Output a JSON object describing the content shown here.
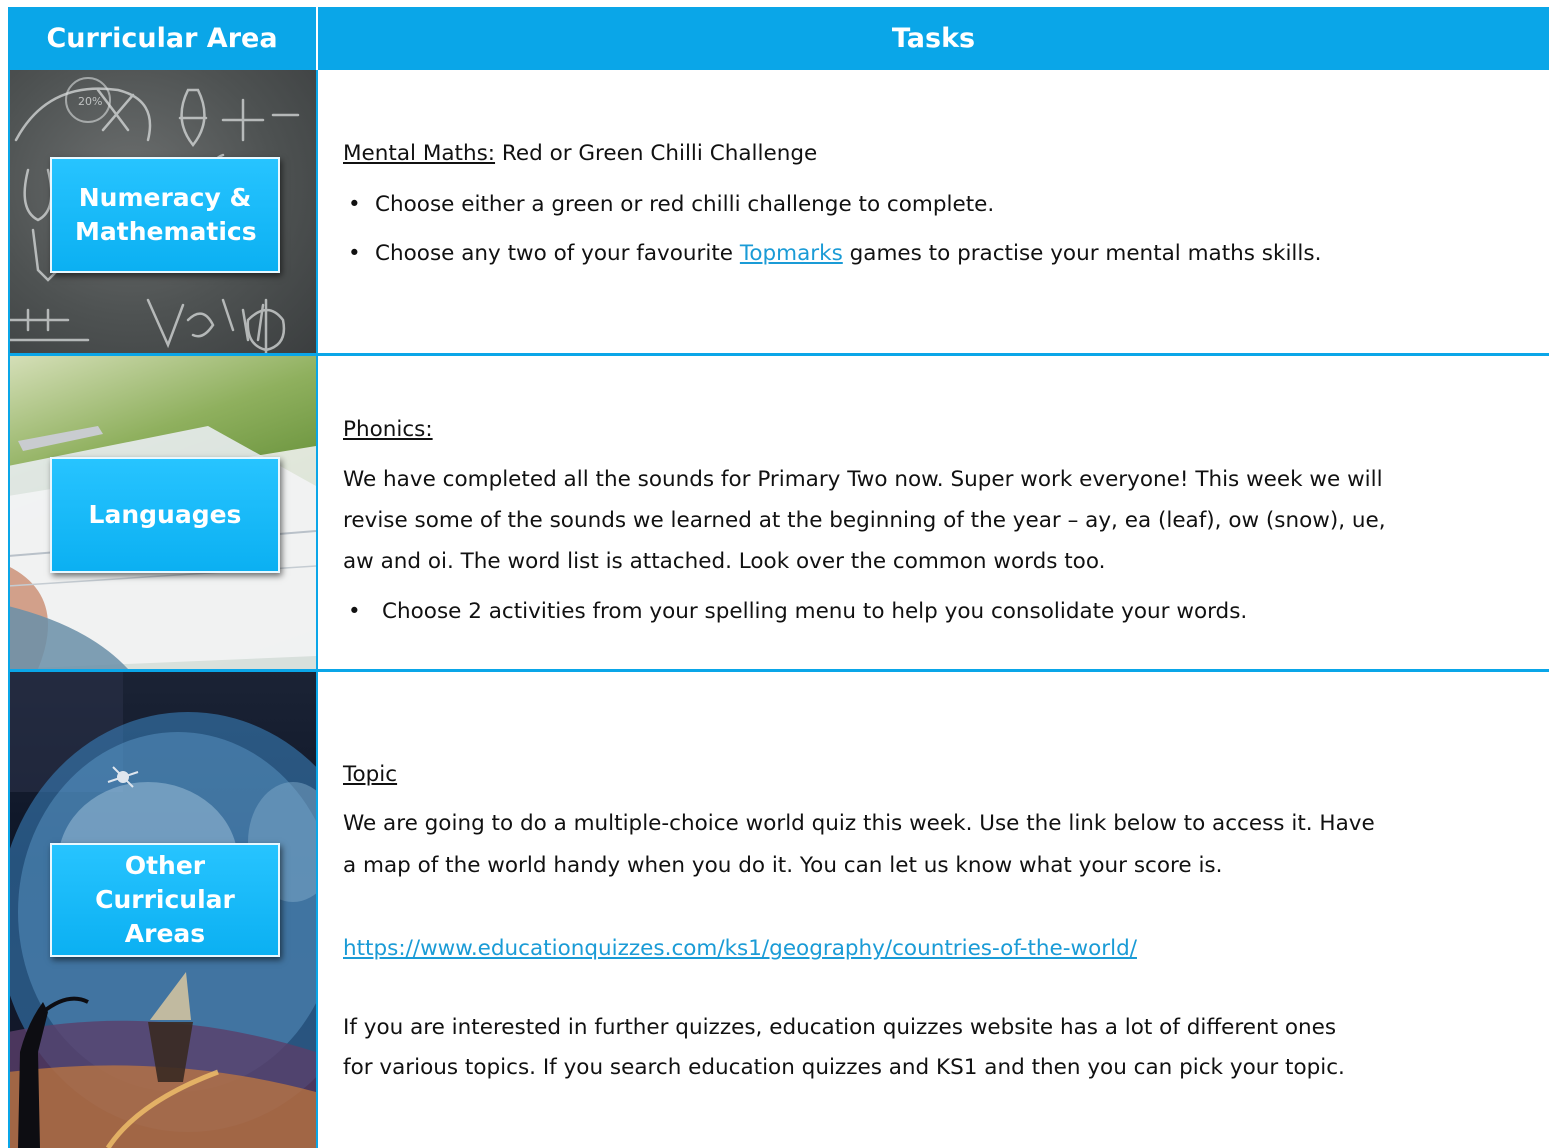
{
  "header": {
    "col1": "Curricular Area",
    "col2": "Tasks"
  },
  "rows": [
    {
      "label": "Numeracy & Mathematics",
      "heading": "Mental Maths:",
      "heading_rest": " Red or Green Chilli Challenge",
      "bullets": [
        "Choose either a green or red chilli challenge to complete.",
        "Choose any two of your favourite "
      ],
      "link_text": "Topmarks",
      "bullet2_rest": " games to practise your mental maths skills."
    },
    {
      "label": "Languages",
      "heading": "Phonics:",
      "para_line1": "We have completed all the sounds for Primary Two now. Super work everyone! This week we will",
      "para_line2": "revise some of the sounds we learned at the beginning of the year – ay, ea (leaf), ow (snow), ue,",
      "para_line3": "aw and oi. The word list is attached. Look over the common words too.",
      "bullet": "Choose 2 activities from your spelling menu to help you consolidate your words."
    },
    {
      "label_line1": "Other",
      "label_line2": "Curricular",
      "label_line3": "Areas",
      "heading": "Topic",
      "para_line1": "We are going to do a multiple-choice world quiz this week. Use the link below to access it. Have",
      "para_line2": "a map of the world handy when you do it. You can let us know what your score is.",
      "url": "https://www.educationquizzes.com/ks1/geography/countries-of-the-world/",
      "para2_line1": "If you are interested in further quizzes, education quizzes website has a lot of different ones",
      "para2_line2": "for various topics. If you search education quizzes and KS1 and then you can pick your topic."
    }
  ],
  "colors": {
    "accent": "#0aa6e8",
    "label_bg": "#1bbcf8",
    "link": "#1a9bd6"
  }
}
